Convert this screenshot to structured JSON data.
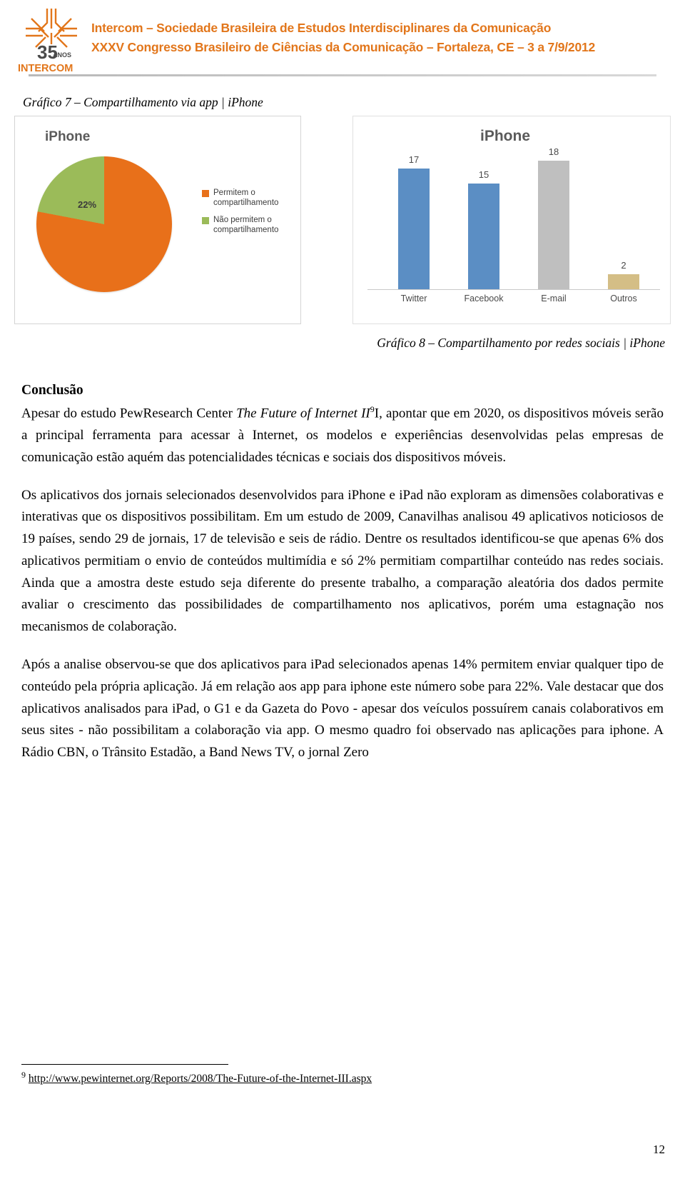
{
  "header": {
    "logo_number": "35",
    "logo_sub": "ANOS",
    "logo_word": "INTERCOM",
    "line1": "Intercom – Sociedade Brasileira de Estudos Interdisciplinares da Comunicação",
    "line2": "XXXV Congresso Brasileiro de Ciências da Comunicação – Fortaleza, CE – 3 a 7/9/2012",
    "accent_color": "#E2761B"
  },
  "captions": {
    "grafico7": "Gráfico 7 – Compartilhamento via app | iPhone",
    "grafico8": "Gráfico 8 – Compartilhamento por redes sociais | iPhone"
  },
  "chart_data": [
    {
      "type": "pie",
      "title": "iPhone",
      "categories": [
        "Permitem o compartilhamento",
        "Não permitem o compartilhamento"
      ],
      "values": [
        78,
        22
      ],
      "value_labels": [
        "78%",
        "22%"
      ],
      "colors": [
        "#E8701A",
        "#9BBB59"
      ],
      "legend_position": "right",
      "grid": false
    },
    {
      "type": "bar",
      "title": "iPhone",
      "categories": [
        "Twitter",
        "Facebook",
        "E-mail",
        "Outros"
      ],
      "values": [
        17,
        15,
        18,
        2
      ],
      "value_labels": [
        "17",
        "15",
        "18",
        "2"
      ],
      "colors": [
        "#5B8EC4",
        "#5B8EC4",
        "#BFBFBF",
        "#D4BE86"
      ],
      "xlabel": "",
      "ylabel": "",
      "ylim": [
        0,
        20
      ],
      "grid": false,
      "legend_position": "none"
    }
  ],
  "content": {
    "section_title": "Conclusão",
    "p1_a": "Apesar do estudo PewResearch Center ",
    "p1_italic": "The Future of Internet II",
    "p1_sup": "9",
    "p1_b": "I, apontar que em 2020, os dispositivos móveis serão a principal ferramenta para acessar à Internet, os modelos e experiências desenvolvidas pelas empresas de comunicação estão aquém das potencialidades técnicas e sociais dos dispositivos móveis.",
    "p2": "Os aplicativos dos jornais selecionados desenvolvidos para iPhone e iPad não exploram as dimensões colaborativas e interativas que os dispositivos possibilitam. Em um estudo de 2009, Canavilhas analisou 49 aplicativos noticiosos de 19 países, sendo 29 de jornais, 17 de televisão e seis de rádio. Dentre os resultados identificou-se que apenas 6% dos aplicativos permitiam o envio de conteúdos multimídia e só 2% permitiam compartilhar conteúdo nas redes sociais. Ainda que a amostra deste estudo seja diferente do presente trabalho, a comparação aleatória dos dados permite avaliar o crescimento das possibilidades de compartilhamento nos aplicativos, porém uma estagnação nos mecanismos de colaboração.",
    "p3": "Após a analise observou-se que dos aplicativos para iPad selecionados apenas 14% permitem enviar qualquer tipo de conteúdo pela própria aplicação. Já em relação aos app para iphone este número sobe para 22%. Vale destacar que dos aplicativos analisados para iPad, o G1 e da Gazeta do Povo  - apesar dos veículos possuírem canais colaborativos em seus sites  - não  possibilitam a colaboração via app.  O mesmo quadro foi observado nas aplicações para iphone. A Rádio CBN, o Trânsito Estadão, a Band News TV, o jornal Zero"
  },
  "footnote": {
    "marker": "9",
    "url": "http://www.pewinternet.org/Reports/2008/The-Future-of-the-Internet-III.aspx"
  },
  "page_number": "12"
}
